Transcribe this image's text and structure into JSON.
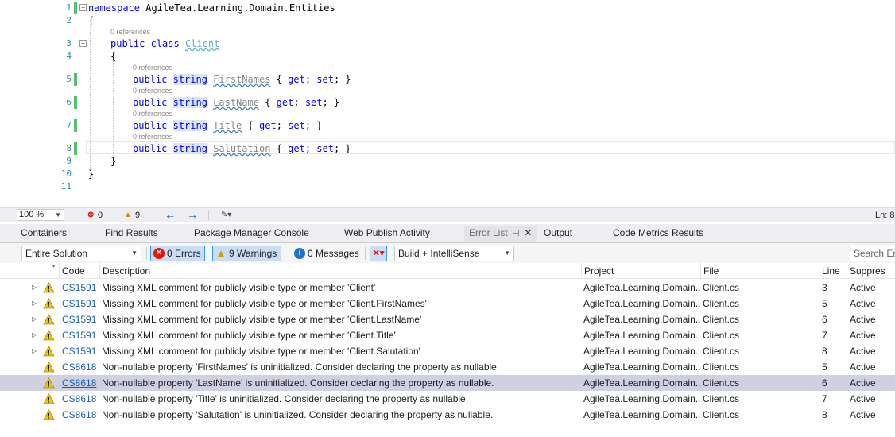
{
  "editor": {
    "lens_text": "0 references",
    "lines": [
      {
        "num": "1",
        "tokens": [
          {
            "t": "namespace",
            "c": "kw"
          },
          {
            "t": " AgileTea.Learning.Domain.Entities",
            "c": ""
          }
        ]
      },
      {
        "num": "2",
        "tokens": [
          {
            "t": "{",
            "c": ""
          }
        ]
      },
      {
        "num": "3",
        "tokens": [
          {
            "t": "public",
            "c": "kw"
          },
          {
            "t": " ",
            "c": ""
          },
          {
            "t": "class",
            "c": "kw"
          },
          {
            "t": " ",
            "c": ""
          },
          {
            "t": "Client",
            "c": "cls"
          }
        ]
      },
      {
        "num": "4",
        "tokens": [
          {
            "t": "{",
            "c": ""
          }
        ]
      },
      {
        "num": "5",
        "tokens": [
          {
            "t": "public",
            "c": "kw"
          },
          {
            "t": " ",
            "c": ""
          },
          {
            "t": "string",
            "c": "kw hl-type"
          },
          {
            "t": " ",
            "c": ""
          },
          {
            "t": "FirstNames",
            "c": "prop"
          },
          {
            "t": " { ",
            "c": ""
          },
          {
            "t": "get",
            "c": "kw"
          },
          {
            "t": "; ",
            "c": ""
          },
          {
            "t": "set",
            "c": "kw"
          },
          {
            "t": "; }",
            "c": ""
          }
        ]
      },
      {
        "num": "6",
        "tokens": [
          {
            "t": "public",
            "c": "kw"
          },
          {
            "t": " ",
            "c": ""
          },
          {
            "t": "string",
            "c": "kw hl-type"
          },
          {
            "t": " ",
            "c": ""
          },
          {
            "t": "LastName",
            "c": "prop"
          },
          {
            "t": " { ",
            "c": ""
          },
          {
            "t": "get",
            "c": "kw"
          },
          {
            "t": "; ",
            "c": ""
          },
          {
            "t": "set",
            "c": "kw"
          },
          {
            "t": "; }",
            "c": ""
          }
        ]
      },
      {
        "num": "7",
        "tokens": [
          {
            "t": "public",
            "c": "kw"
          },
          {
            "t": " ",
            "c": ""
          },
          {
            "t": "string",
            "c": "kw hl-type"
          },
          {
            "t": " ",
            "c": ""
          },
          {
            "t": "Title",
            "c": "prop"
          },
          {
            "t": " { ",
            "c": ""
          },
          {
            "t": "get",
            "c": "kw"
          },
          {
            "t": "; ",
            "c": ""
          },
          {
            "t": "set",
            "c": "kw"
          },
          {
            "t": "; }",
            "c": ""
          }
        ]
      },
      {
        "num": "8",
        "tokens": [
          {
            "t": "public",
            "c": "kw"
          },
          {
            "t": " ",
            "c": ""
          },
          {
            "t": "string",
            "c": "kw hl-type"
          },
          {
            "t": " ",
            "c": ""
          },
          {
            "t": "Salutation",
            "c": "prop"
          },
          {
            "t": " { ",
            "c": ""
          },
          {
            "t": "get",
            "c": "kw"
          },
          {
            "t": "; ",
            "c": ""
          },
          {
            "t": "set",
            "c": "kw"
          },
          {
            "t": "; }",
            "c": ""
          }
        ]
      },
      {
        "num": "9",
        "tokens": [
          {
            "t": "}",
            "c": ""
          }
        ]
      },
      {
        "num": "10",
        "tokens": [
          {
            "t": "}",
            "c": ""
          }
        ]
      },
      {
        "num": "11",
        "tokens": []
      }
    ]
  },
  "editor_status": {
    "zoom": "100 %",
    "error_count": "0",
    "warning_count": "9",
    "position": "Ln: 8"
  },
  "tabs": {
    "containers": "Containers",
    "find_results": "Find Results",
    "package_manager_console": "Package Manager Console",
    "web_publish_activity": "Web Publish Activity",
    "error_list": "Error List",
    "pin_glyph": "⊣",
    "close_glyph": "✕",
    "output": "Output",
    "code_metrics_results": "Code Metrics Results"
  },
  "error_toolbar": {
    "scope": "Entire Solution",
    "errors": "0 Errors",
    "warnings": "9 Warnings",
    "messages": "0 Messages",
    "build_filter": "Build + IntelliSense",
    "search_placeholder": "Search Error List"
  },
  "grid": {
    "columns": {
      "code": "Code",
      "description": "Description",
      "project": "Project",
      "file": "File",
      "line": "Line",
      "suppression": "Suppres"
    },
    "rows": [
      {
        "code": "CS1591",
        "description": "Missing XML comment for publicly visible type or member 'Client'",
        "project": "AgileTea.Learning.Domain...",
        "file": "Client.cs",
        "line": "3",
        "suppression": "Active",
        "expandable": true,
        "selected": false
      },
      {
        "code": "CS1591",
        "description": "Missing XML comment for publicly visible type or member 'Client.FirstNames'",
        "project": "AgileTea.Learning.Domain...",
        "file": "Client.cs",
        "line": "5",
        "suppression": "Active",
        "expandable": true,
        "selected": false
      },
      {
        "code": "CS1591",
        "description": "Missing XML comment for publicly visible type or member 'Client.LastName'",
        "project": "AgileTea.Learning.Domain...",
        "file": "Client.cs",
        "line": "6",
        "suppression": "Active",
        "expandable": true,
        "selected": false
      },
      {
        "code": "CS1591",
        "description": "Missing XML comment for publicly visible type or member 'Client.Title'",
        "project": "AgileTea.Learning.Domain...",
        "file": "Client.cs",
        "line": "7",
        "suppression": "Active",
        "expandable": true,
        "selected": false
      },
      {
        "code": "CS1591",
        "description": "Missing XML comment for publicly visible type or member 'Client.Salutation'",
        "project": "AgileTea.Learning.Domain...",
        "file": "Client.cs",
        "line": "8",
        "suppression": "Active",
        "expandable": true,
        "selected": false
      },
      {
        "code": "CS8618",
        "description": "Non-nullable property 'FirstNames' is uninitialized. Consider declaring the property as nullable.",
        "project": "AgileTea.Learning.Domain...",
        "file": "Client.cs",
        "line": "5",
        "suppression": "Active",
        "expandable": false,
        "selected": false
      },
      {
        "code": "CS8618",
        "description": "Non-nullable property 'LastName' is uninitialized. Consider declaring the property as nullable.",
        "project": "AgileTea.Learning.Domain...",
        "file": "Client.cs",
        "line": "6",
        "suppression": "Active",
        "expandable": false,
        "selected": true
      },
      {
        "code": "CS8618",
        "description": "Non-nullable property 'Title' is uninitialized. Consider declaring the property as nullable.",
        "project": "AgileTea.Learning.Domain...",
        "file": "Client.cs",
        "line": "7",
        "suppression": "Active",
        "expandable": false,
        "selected": false
      },
      {
        "code": "CS8618",
        "description": "Non-nullable property 'Salutation' is uninitialized. Consider declaring the property as nullable.",
        "project": "AgileTea.Learning.Domain...",
        "file": "Client.cs",
        "line": "8",
        "suppression": "Active",
        "expandable": false,
        "selected": false
      }
    ]
  }
}
